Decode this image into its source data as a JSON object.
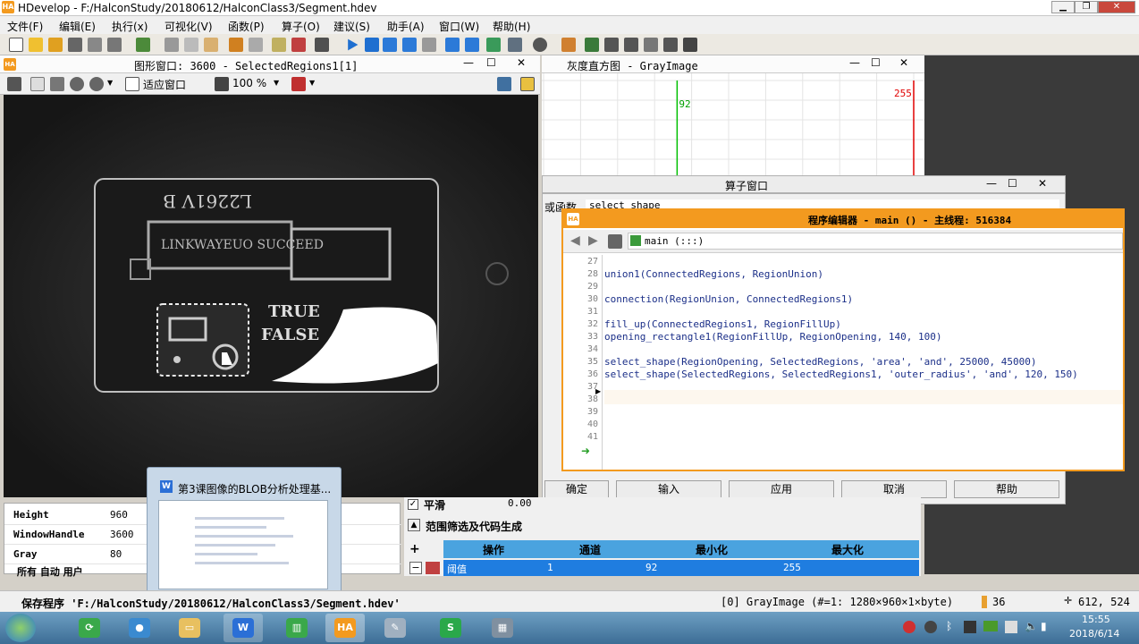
{
  "app": {
    "title": "HDevelop - F:/HalconStudy/20180612/HalconClass3/Segment.hdev",
    "logo_text": "HA"
  },
  "menu": [
    "文件(F)",
    "编辑(E)",
    "执行(x)",
    "可视化(V)",
    "函数(P)",
    "算子(O)",
    "建议(S)",
    "助手(A)",
    "窗口(W)",
    "帮助(H)"
  ],
  "graphics_window": {
    "title": "图形窗口: 3600 - SelectedRegions1[1]",
    "fit_label": "适应窗口",
    "zoom_label": "100 %"
  },
  "histogram": {
    "title": "灰度直方图 - GrayImage",
    "min_marker": "92",
    "max_marker": "255",
    "min_value": 92,
    "max_value": 255
  },
  "operator_window": {
    "title": "算子窗口",
    "label": "或函数",
    "field_value": "select_shape",
    "buttons": [
      "确定",
      "输入",
      "应用",
      "取消",
      "帮助"
    ]
  },
  "program_editor": {
    "title": "程序编辑器 - main () - 主线程: 516384",
    "proc": "main (:::)",
    "lines": [
      {
        "n": "27",
        "code": ""
      },
      {
        "n": "28",
        "code": "union1(ConnectedRegions, RegionUnion)"
      },
      {
        "n": "29",
        "code": ""
      },
      {
        "n": "30",
        "code": "connection(RegionUnion, ConnectedRegions1)"
      },
      {
        "n": "31",
        "code": ""
      },
      {
        "n": "32",
        "code": "fill_up(ConnectedRegions1, RegionFillUp)"
      },
      {
        "n": "33",
        "code": "opening_rectangle1(RegionFillUp, RegionOpening, 140, 100)"
      },
      {
        "n": "34",
        "code": ""
      },
      {
        "n": "35",
        "code": "select_shape(RegionOpening, SelectedRegions, 'area', 'and', 25000, 45000)"
      },
      {
        "n": "36",
        "code": "select_shape(SelectedRegions, SelectedRegions1, 'outer_radius', 'and', 120, 150)"
      },
      {
        "n": "37",
        "code": ""
      },
      {
        "n": "38",
        "code": ""
      },
      {
        "n": "39",
        "code": ""
      },
      {
        "n": "40",
        "code": ""
      },
      {
        "n": "41",
        "code": ""
      }
    ]
  },
  "properties": {
    "rows": [
      {
        "key": "Height",
        "value": "960"
      },
      {
        "key": "WindowHandle",
        "value": "3600"
      },
      {
        "key": "Gray",
        "value": "80"
      }
    ],
    "tabs_label": "所有 自动 用户"
  },
  "range_panel": {
    "smooth_label": "平滑",
    "smooth_value": "0.00",
    "section_title": "范围筛选及代码生成",
    "headers": [
      "操作",
      "通道",
      "最小化",
      "最大化"
    ],
    "row": {
      "op": "阈值",
      "channel": "1",
      "min": "92",
      "max": "255"
    }
  },
  "thumbnail": {
    "title": "第3课图像的BLOB分析处理基..."
  },
  "status": {
    "save": "保存程序 'F:/HalconStudy/20180612/HalconClass3/Segment.hdev'",
    "image": "[0] GrayImage (#=1: 1280×960×1×byte)",
    "gray": "36",
    "coords": "612, 524"
  },
  "clock": {
    "time": "15:55",
    "date": "2018/6/14"
  },
  "image_text": {
    "label_top": "L2261V B",
    "label_mid": "LINKWAYEUO SUCCEED",
    "true": "TRUE",
    "false": "FALSE"
  },
  "colors": {
    "accent": "#f39a1f",
    "code": "#1b2f88",
    "table_head": "#4aa3df",
    "table_row": "#1f7de0",
    "hist_green": "#00c000",
    "hist_red": "#e00000"
  }
}
